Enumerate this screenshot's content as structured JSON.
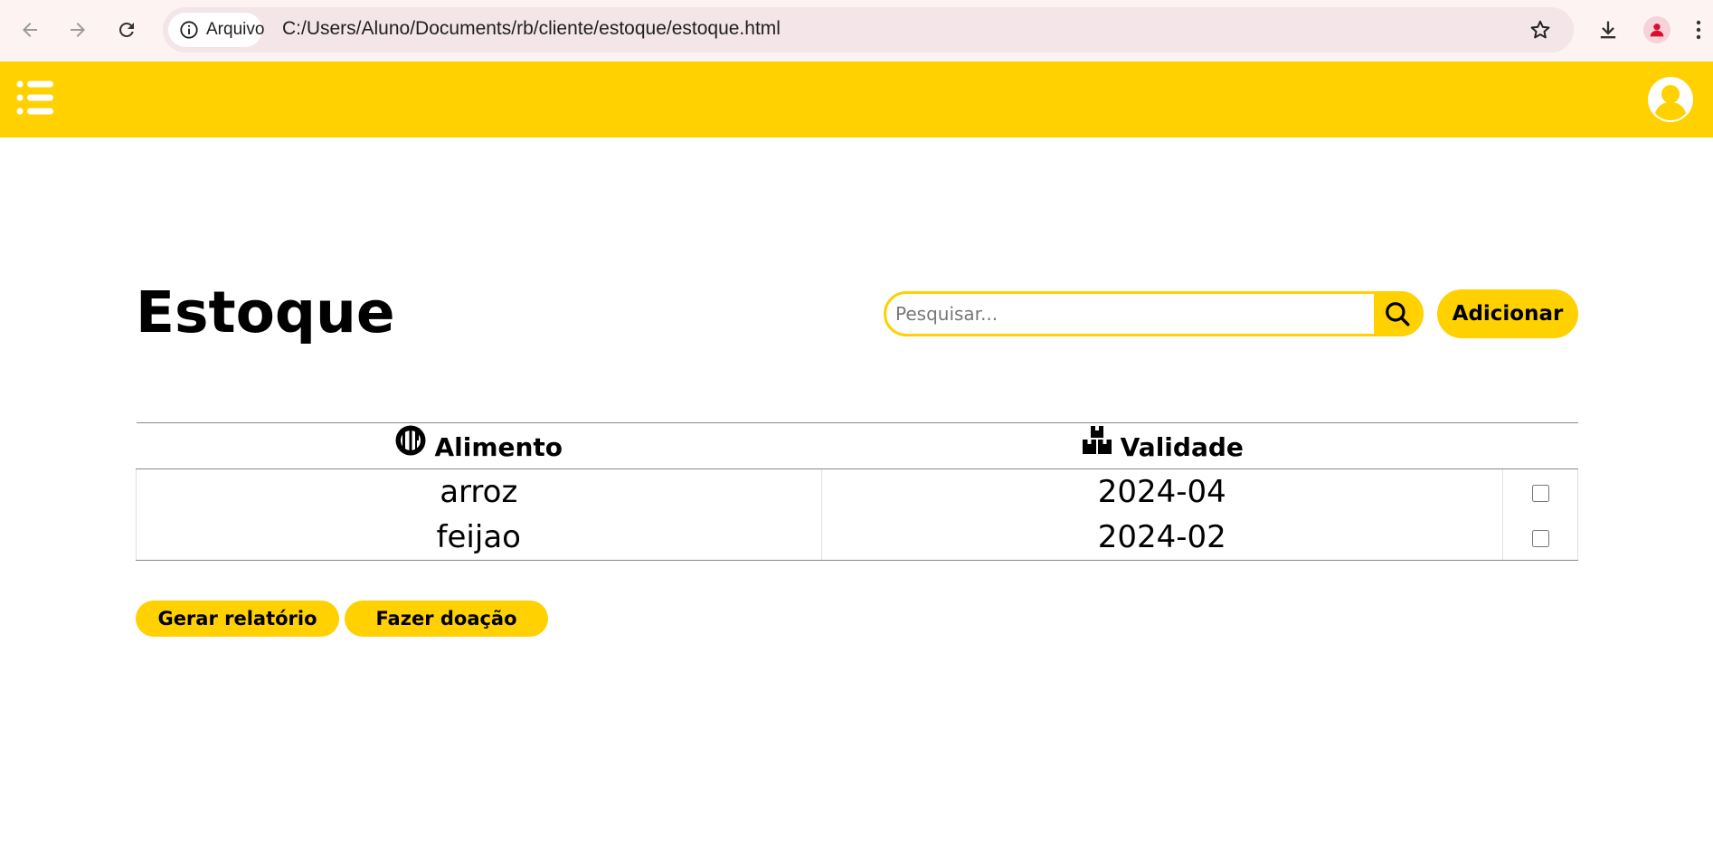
{
  "browser": {
    "site_chip_label": "Arquivo",
    "url": "C:/Users/Aluno/Documents/rb/cliente/estoque/estoque.html",
    "icons": [
      "back-arrow-icon",
      "forward-arrow-icon",
      "reload-icon",
      "info-icon",
      "star-icon",
      "download-icon",
      "profile-icon",
      "more-vert-icon"
    ]
  },
  "header": {
    "background_color": "#ffd100",
    "icons": [
      "menu-list-icon",
      "user-avatar-icon"
    ]
  },
  "main": {
    "title": "Estoque",
    "search": {
      "placeholder": "Pesquisar...",
      "value": ""
    },
    "add_label": "Adicionar",
    "table": {
      "headers": [
        {
          "label": "Alimento",
          "icon": "utensils-icon"
        },
        {
          "label": "Validade",
          "icon": "boxes-icon"
        }
      ],
      "rows": [
        {
          "alimento": "arroz",
          "validade": "2024-04",
          "checked": false
        },
        {
          "alimento": "feijao",
          "validade": "2024-02",
          "checked": false
        }
      ]
    },
    "actions": {
      "report_label": "Gerar relatório",
      "donate_label": "Fazer doação"
    }
  },
  "colors": {
    "accent": "#ffd100",
    "text": "#000000"
  }
}
